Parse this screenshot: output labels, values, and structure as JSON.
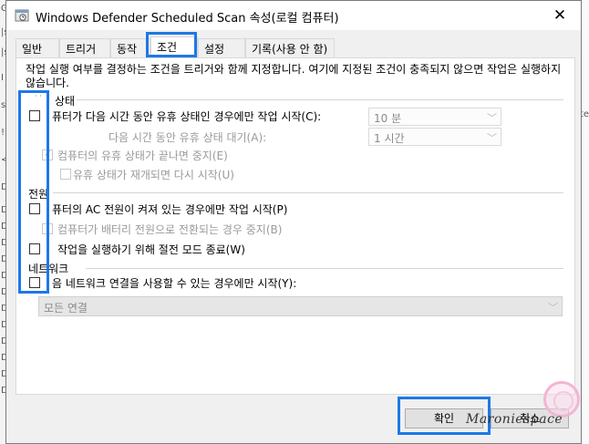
{
  "background": {
    "left_fragments": [
      "G",
      "|s",
      "|s",
      "I",
      "s",
      "!",
      "<",
      "D",
      "De",
      "De",
      "De",
      "De",
      "De",
      "De",
      "De",
      "De",
      "De",
      "De",
      "De",
      "De"
    ],
    "right_fragments": [
      "",
      "te"
    ]
  },
  "window": {
    "title": "Windows Defender Scheduled Scan 속성(로컬 컴퓨터)",
    "close_glyph": "✕",
    "accent_color": "#1e78e6"
  },
  "tabs": [
    {
      "label": "일반"
    },
    {
      "label": "트리거"
    },
    {
      "label": "동작"
    },
    {
      "label": "조건",
      "active": true
    },
    {
      "label": "설정"
    },
    {
      "label": "기록(사용 안 함)"
    }
  ],
  "conditions": {
    "description": "작업 실행 여부를 결정하는 조건을 트리거와 함께 지정합니다. 여기에 지정된 조건이 충족되지 않으면 작업은 실행하지 않습니다.",
    "idle_group": "상태",
    "idle_group_prefix": "·  ·",
    "idle_start": {
      "label": "퓨터가 다음 시간 동안 유휴 상태인 경우에만 작업 시작(C):",
      "checked": false,
      "value": "10 분"
    },
    "idle_wait": {
      "label": "다음 시간 동안 유휴 상태 대기(A):",
      "value": "1 시간"
    },
    "idle_stop": {
      "label": "컴퓨터의 유휴 상태가 끝나면 중지(E)",
      "checked": true
    },
    "idle_restart": {
      "label": "유휴 상태가 재개되면 다시 시작(U)",
      "checked": false
    },
    "power_group": "전원",
    "power_ac": {
      "label": "퓨터의 AC 전원이 켜져 있는 경우에만 작업 시작(P)",
      "checked": false
    },
    "power_battery": {
      "label": "컴퓨터가 배터리 전원으로 전환되는 경우 중지(B)",
      "checked": false
    },
    "power_wake": {
      "label": "작업을 실행하기 위해 절전 모드 종료(W)",
      "checked": false
    },
    "network_group": "네트워크",
    "network_start": {
      "label": "음 네트워크 연결을 사용할 수 있는 경우에만 시작(Y):",
      "checked": false
    },
    "network_select": "모든 연결"
  },
  "buttons": {
    "ok": "확인",
    "cancel": "취소"
  },
  "watermark": "Maroniespace"
}
